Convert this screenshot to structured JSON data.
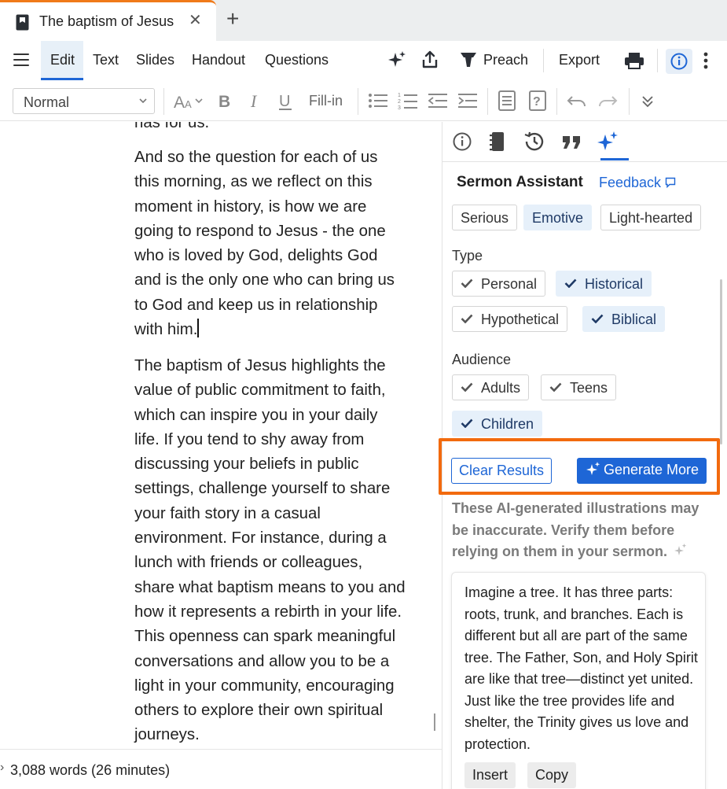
{
  "tab": {
    "title": "The baptism of Jesus",
    "close": "✕",
    "new": "+"
  },
  "menubar": {
    "items": [
      "Edit",
      "Text",
      "Slides",
      "Handout",
      "Questions"
    ],
    "preach": "Preach",
    "export": "Export"
  },
  "toolbar": {
    "style": "Normal",
    "fill_in": "Fill-in"
  },
  "editor": {
    "partial_line": "has for us.",
    "paragraph1": "And so the question for each of us this morning, as we reflect on this moment in history, is how we are going to respond to Jesus - the one who is loved by God, delights God and is the only one who can bring us to God and keep us in relationship with him.",
    "paragraph2": "The baptism of Jesus highlights the value of public commitment to faith, which can inspire you in your daily life. If you tend to shy away from discussing your beliefs in public settings, challenge yourself to share your faith story in a casual environment. For instance, during a lunch with friends or colleagues, share what baptism means to you and how it represents a rebirth in your life. This openness can spark meaningful conversations and allow you to be a light in your community, encouraging others to explore their own spiritual journeys.",
    "word_count": "3,088 words (26 minutes)"
  },
  "panel": {
    "title": "Sermon Assistant",
    "feedback": "Feedback",
    "tones": [
      {
        "label": "Serious",
        "selected": false
      },
      {
        "label": "Emotive",
        "selected": true
      },
      {
        "label": "Light-hearted",
        "selected": false
      }
    ],
    "type_label": "Type",
    "types": [
      {
        "label": "Personal",
        "selected": false
      },
      {
        "label": "Historical",
        "selected": true
      },
      {
        "label": "Hypothetical",
        "selected": false
      },
      {
        "label": "Biblical",
        "selected": true
      }
    ],
    "audience_label": "Audience",
    "audiences": [
      {
        "label": "Adults",
        "selected": false
      },
      {
        "label": "Teens",
        "selected": false
      },
      {
        "label": "Children",
        "selected": true
      }
    ],
    "clear_results": "Clear Results",
    "generate_more": "Generate More",
    "disclaimer": "These AI-generated illustrations may be inaccurate. Verify them before relying on them in your sermon.",
    "illustration": "Imagine a tree. It has three parts: roots, trunk, and branches. Each is different but all are part of the same tree. The Father, Son, and Holy Spirit are like that tree—distinct yet united. Just like the tree provides life and shelter, the Trinity gives us love and protection.",
    "insert": "Insert",
    "copy": "Copy"
  },
  "colors": {
    "accent": "#1e66d6",
    "highlight": "#f26a0e",
    "selected_chip": "#e6f0fa"
  }
}
